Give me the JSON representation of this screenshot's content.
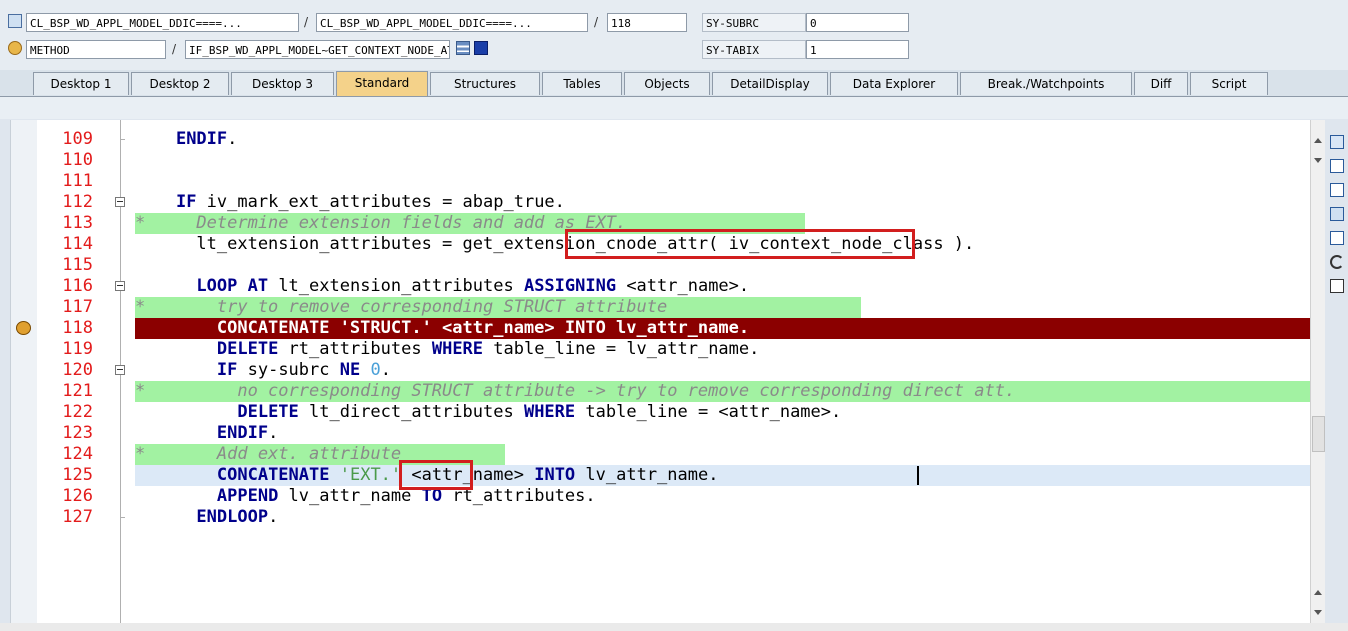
{
  "header": {
    "row1": {
      "program": "CL_BSP_WD_APPL_MODEL_DDIC====...",
      "include": "CL_BSP_WD_APPL_MODEL_DDIC====...",
      "line": "118",
      "sysvar_label": "SY-SUBRC",
      "sysvar_value": "0"
    },
    "row2": {
      "event_type": "METHOD",
      "event_name": "IF_BSP_WD_APPL_MODEL~GET_CONTEXT_NODE_ATT...",
      "sysvar_label": "SY-TABIX",
      "sysvar_value": "1"
    },
    "sep": "/"
  },
  "tabs": [
    {
      "label": "Desktop 1"
    },
    {
      "label": "Desktop 2"
    },
    {
      "label": "Desktop 3"
    },
    {
      "label": "Standard"
    },
    {
      "label": "Structures"
    },
    {
      "label": "Tables"
    },
    {
      "label": "Objects"
    },
    {
      "label": "DetailDisplay"
    },
    {
      "label": "Data Explorer"
    },
    {
      "label": "Break./Watchpoints"
    },
    {
      "label": "Diff"
    },
    {
      "label": "Script"
    }
  ],
  "code": {
    "lines": [
      {
        "n": "109",
        "p": [
          "    ",
          {
            "k": "ENDIF"
          },
          "."
        ]
      },
      {
        "n": "110",
        "p": []
      },
      {
        "n": "111",
        "p": []
      },
      {
        "n": "112",
        "p": [
          "    ",
          {
            "k": "IF"
          },
          " iv_mark_ext_attributes = abap_true."
        ]
      },
      {
        "n": "113",
        "p": [
          {
            "c": "*     Determine extension fields and add as EXT."
          }
        ]
      },
      {
        "n": "114",
        "p": [
          "      lt_extension_attributes = get_extension_cnode_attr( iv_context_node_class )."
        ]
      },
      {
        "n": "115",
        "p": []
      },
      {
        "n": "116",
        "p": [
          "      ",
          {
            "k": "LOOP AT"
          },
          " lt_extension_attributes ",
          {
            "k": "ASSIGNING"
          },
          " <attr_name>."
        ]
      },
      {
        "n": "117",
        "p": [
          {
            "c": "*       try to remove corresponding STRUCT attribute"
          }
        ]
      },
      {
        "n": "118",
        "p": [
          "        CONCATENATE 'STRUCT.' <attr_name> INTO lv_attr_name."
        ]
      },
      {
        "n": "119",
        "p": [
          "        ",
          {
            "k": "DELETE"
          },
          " rt_attributes ",
          {
            "k": "WHERE"
          },
          " table_line = lv_attr_name."
        ]
      },
      {
        "n": "120",
        "p": [
          "        ",
          {
            "k": "IF"
          },
          " sy-subrc ",
          {
            "k": "NE"
          },
          " ",
          {
            "num": "0"
          },
          "."
        ]
      },
      {
        "n": "121",
        "p": [
          {
            "c": "*         no corresponding STRUCT attribute -> try to remove corresponding direct att."
          }
        ]
      },
      {
        "n": "122",
        "p": [
          "          ",
          {
            "k": "DELETE"
          },
          " lt_direct_attributes ",
          {
            "k": "WHERE"
          },
          " table_line = <attr_name>."
        ]
      },
      {
        "n": "123",
        "p": [
          "        ",
          {
            "k": "ENDIF"
          },
          "."
        ]
      },
      {
        "n": "124",
        "p": [
          {
            "c": "*       Add ext. attribute"
          }
        ]
      },
      {
        "n": "125",
        "p": [
          "        ",
          {
            "k": "CONCATENATE"
          },
          " ",
          {
            "s": "'EXT.'"
          },
          " <attr_name> ",
          {
            "k": "INTO"
          },
          " lv_attr_name."
        ]
      },
      {
        "n": "126",
        "p": [
          "        ",
          {
            "k": "APPEND"
          },
          " lv_attr_name ",
          {
            "k": "TO"
          },
          " rt_attributes."
        ]
      },
      {
        "n": "127",
        "p": [
          "      ",
          {
            "k": "ENDLOOP"
          },
          "."
        ]
      }
    ]
  },
  "colors": {
    "breakpoint_line": "#8b0000",
    "comment_bg": "#a2f2a2",
    "line_numbers": "#e31b1b",
    "highlight_box": "#d21e1e"
  },
  "icons": [
    "program-icon",
    "method-icon",
    "callstack-icon",
    "info-icon",
    "breakpoint-arrow-icon",
    "fold-collapse-icon",
    "close-icon",
    "new-icon",
    "layout-icon",
    "full-screen-icon",
    "back-icon",
    "refresh-icon",
    "settings-icon"
  ]
}
